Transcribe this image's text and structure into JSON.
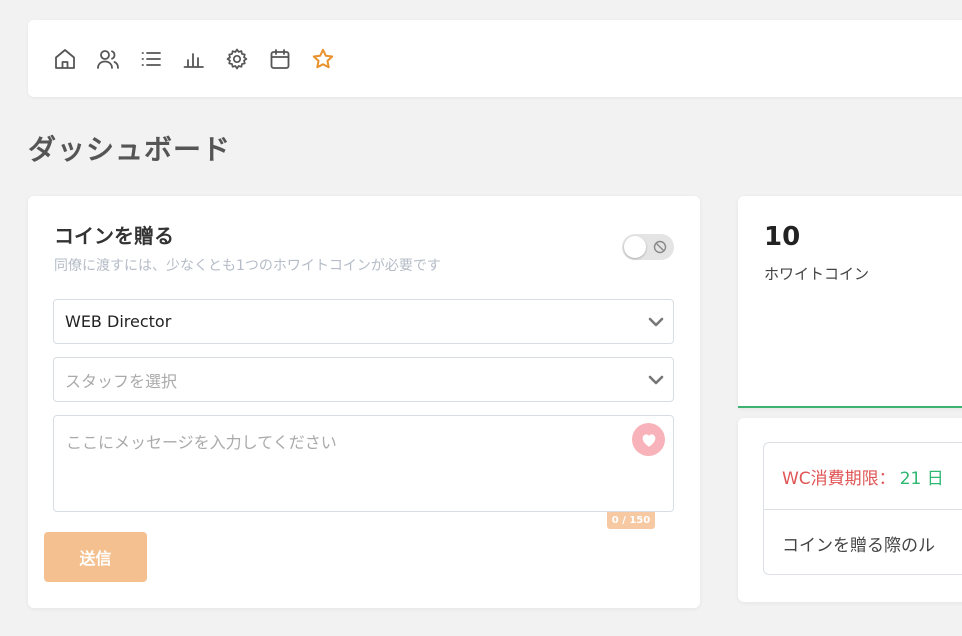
{
  "nav": {
    "icons": [
      "home-icon",
      "users-icon",
      "list-icon",
      "bar-chart-icon",
      "gear-icon",
      "calendar-icon",
      "star-icon"
    ],
    "active_color": "#e8912d",
    "icon_color": "#555555"
  },
  "page": {
    "title": "ダッシュボード"
  },
  "send_coin": {
    "title": "コインを贈る",
    "subtitle": "同僚に渡すには、少なくとも1つのホワイトコインが必要です",
    "department_value": "WEB Director",
    "staff_placeholder": "スタッフを選択",
    "message_placeholder": "ここにメッセージを入力してください",
    "char_counter": "0 / 150",
    "send_label": "送信"
  },
  "stats": {
    "white_coin_count": "10",
    "white_coin_label": "ホワイトコイン"
  },
  "info": {
    "wc_expiry_label": "WC消費期限：",
    "wc_expiry_value": "21 日",
    "rules_link": "コインを贈る際のル"
  },
  "colors": {
    "accent_orange": "#f5c08f",
    "heart_pink": "#f7b3b9",
    "expiry_red": "#e05555",
    "expiry_green": "#2eb872"
  }
}
